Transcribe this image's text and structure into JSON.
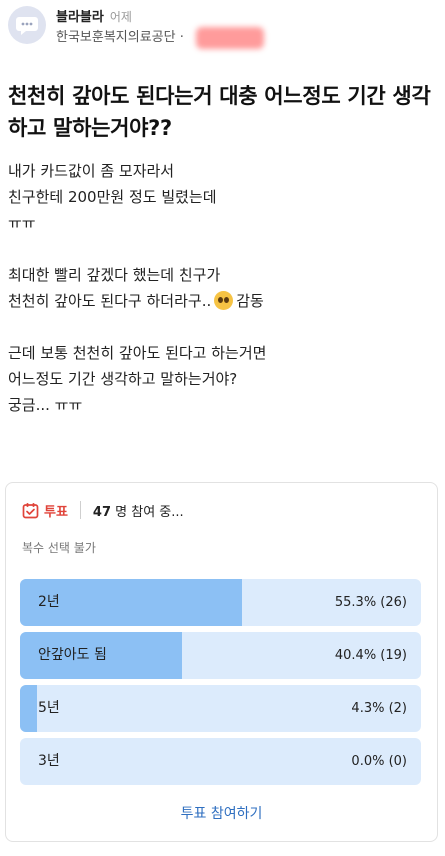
{
  "post": {
    "username": "블라블라",
    "time": "어제",
    "company": "한국보훈복지의료공단 ·",
    "title": "천천히 갚아도 된다는거 대충 어느정도 기간 생각하고 말하는거야??",
    "body": {
      "line1": "내가 카드값이 좀 모자라서",
      "line2": "친구한테 200만원 정도 빌렸는데",
      "line3": "ㅠㅠ",
      "line4": "최대한 빨리 갚겠다 했는데 친구가",
      "line5_before": "천천히 갚아도 된다구 하더라구..",
      "line5_after": "감동",
      "line6": "근데 보통 천천히 갚아도 된다고 하는거면",
      "line7": "어느정도 기간 생각하고 말하는거야?",
      "line8": "궁금... ㅠㅠ"
    }
  },
  "poll": {
    "tag": "투표",
    "participants_num": "47",
    "participants_text": "명 참여 중...",
    "rule": "복수 선택 불가",
    "options": [
      {
        "label": "2년",
        "result": "55.3% (26)",
        "fraction": 0.553
      },
      {
        "label": "안갚아도 됨",
        "result": "40.4% (19)",
        "fraction": 0.404
      },
      {
        "label": "5년",
        "result": "4.3% (2)",
        "fraction": 0.043
      },
      {
        "label": "3년",
        "result": "0.0% (0)",
        "fraction": 0.0
      }
    ],
    "vote_button": "투표 참여하기"
  },
  "colors": {
    "accent_red": "#e0443a",
    "bar_fill": "#8cc0f4",
    "bar_bg": "#dcebfc",
    "link_blue": "#2f6fc0"
  },
  "icons": {
    "avatar": "chat-bubble-icon",
    "poll": "ballot-box-icon",
    "emoji": "pleading-face-emoji"
  }
}
